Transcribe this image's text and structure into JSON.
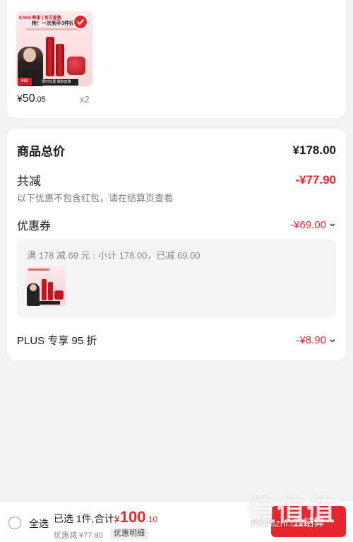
{
  "product": {
    "brand": "KANS 韩束 | 官方直营",
    "headline": "抢！一次到手3件好物",
    "price_tag": "¥89",
    "banner": "限时优惠 爆款直降",
    "price_yen": "¥",
    "price_int": "50",
    "price_dec": ".05",
    "quantity": "x2"
  },
  "summary_card": {
    "total_label": "商品总价",
    "total_value": "¥178.00",
    "reduction_label": "共减",
    "reduction_value": "-¥77.90",
    "note": "以下优惠不包含红包，请在结算页查看",
    "coupon_label": "优惠券",
    "coupon_value": "-¥69.00",
    "coupon_desc_main": "满 178 减 69 元",
    "coupon_desc_sub": "小计 178.00，已减 69.00",
    "plus_label": "PLUS 专享 95 折",
    "plus_value": "-¥8.90"
  },
  "bottom_bar": {
    "select_all": "全选",
    "selected_summary": "已选 1件,合计:",
    "amount_yen": "¥",
    "amount_int": "100",
    "amount_dec": ".10",
    "discount_note": "优惠减:¥77.90",
    "detail_button": "优惠明细",
    "checkout_button": "去结算"
  },
  "watermark": {
    "big": "值值值",
    "small": "zhizhizhi.com"
  },
  "colors": {
    "accent": "#e8262f",
    "background": "#f2f2f2"
  },
  "icons": [
    "check-circle-icon",
    "chevron-down-icon",
    "radio-icon"
  ]
}
